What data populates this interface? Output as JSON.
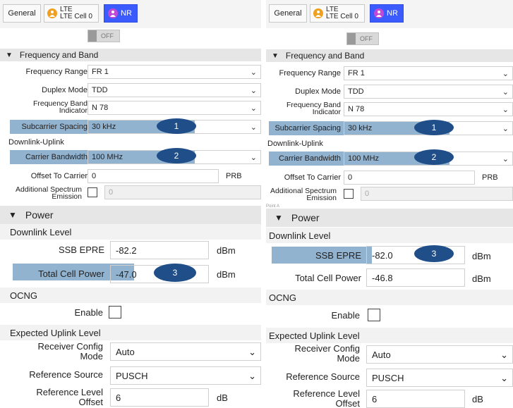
{
  "tabs": {
    "general": "General",
    "lte_line1": "LTE",
    "lte_line2": "LTE Cell 0",
    "nr": "NR"
  },
  "toggle_label": "OFF",
  "freq_section": "Frequency and Band",
  "fields": {
    "frequency_range": {
      "label": "Frequency Range",
      "value": "FR 1"
    },
    "duplex_mode": {
      "label": "Duplex Mode",
      "value": "TDD"
    },
    "band_indicator": {
      "label1": "Frequency Band",
      "label2": "Indicator",
      "value": "N 78"
    },
    "scs": {
      "label": "Subcarrier Spacing",
      "value": "30 kHz"
    },
    "downlink_uplink": "Downlink-Uplink",
    "carrier_bw": {
      "label": "Carrier Bandwidth",
      "value": "100 MHz"
    },
    "offset": {
      "label": "Offset To Carrier",
      "value": "0",
      "unit": "PRB"
    },
    "ase": {
      "label1": "Additional Spectrum",
      "label2": "Emission",
      "value": "0"
    }
  },
  "power_section": "Power",
  "downlink_level": "Downlink Level",
  "ocng": "OCNG",
  "enable_label": "Enable",
  "expected_uplink": "Expected Uplink Level",
  "power_fields": {
    "ssb_epre_label": "SSB EPRE",
    "total_cell_power_label": "Total Cell Power",
    "unit_dbm": "dBm",
    "receiver_config_1": "Receiver Config",
    "receiver_config_2": "Mode",
    "receiver_config_value": "Auto",
    "reference_source_label": "Reference Source",
    "reference_source_value": "PUSCH",
    "ref_level_1": "Reference Level",
    "ref_level_2": "Offset",
    "ref_level_value": "6",
    "unit_db": "dB"
  },
  "left": {
    "ssb_epre": "-82.2",
    "total_cell_power": "-47.0"
  },
  "right": {
    "ssb_epre": "-82.0",
    "total_cell_power": "-46.8",
    "small_label": "Point A"
  },
  "badges": {
    "one": "1",
    "two": "2",
    "three": "3"
  },
  "colors": {
    "highlight": "#7fa6c8",
    "badge": "#1f4e88",
    "nr_tab": "#3b5bff"
  }
}
